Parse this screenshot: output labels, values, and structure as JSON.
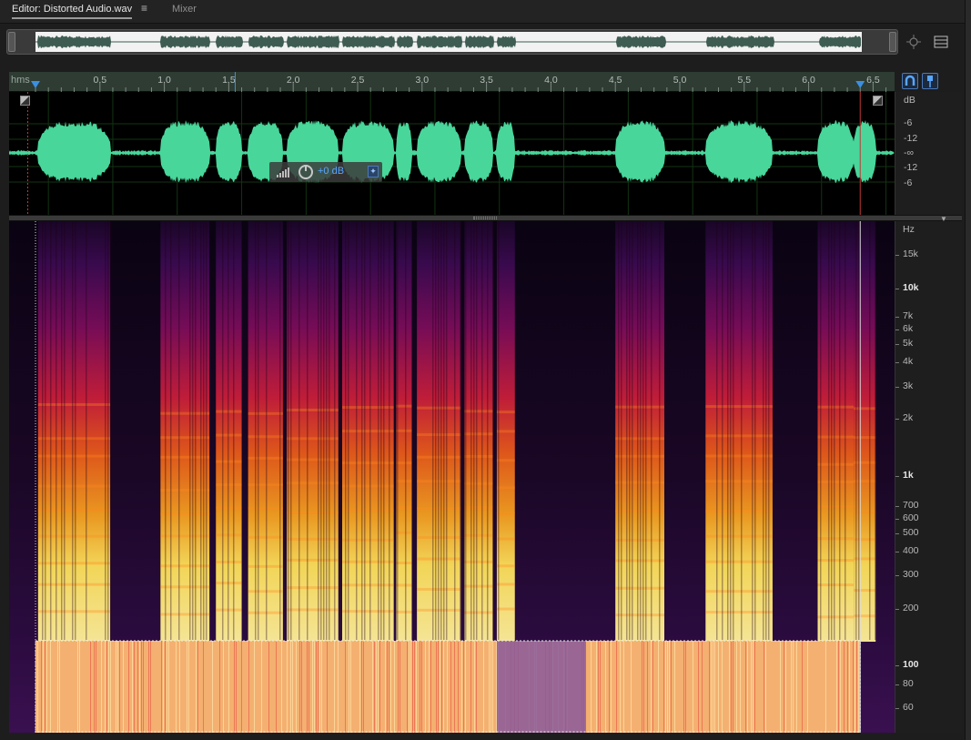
{
  "tabs": {
    "editor_label": "Editor: Distorted Audio.wav",
    "menu_glyph": "≡",
    "mixer_label": "Mixer"
  },
  "ruler": {
    "unit_label": "hms",
    "ticks": [
      "0.5",
      "1.0",
      "1.5",
      "2.0",
      "2.5",
      "3.0",
      "3.5",
      "4.0",
      "4.5",
      "5.0",
      "5.5",
      "6.0",
      "6.5"
    ]
  },
  "waveform": {
    "scale_unit": "dB",
    "scale_labels": [
      "-6",
      "-12",
      "-∞",
      "-12",
      "-6"
    ],
    "gain_hud": "+0 dB"
  },
  "spectral": {
    "scale_unit": "Hz",
    "freq_labels": [
      {
        "text": "15k",
        "bold": false
      },
      {
        "text": "10k",
        "bold": true
      },
      {
        "text": "7k",
        "bold": false
      },
      {
        "text": "6k",
        "bold": false
      },
      {
        "text": "5k",
        "bold": false
      },
      {
        "text": "4k",
        "bold": false
      },
      {
        "text": "3k",
        "bold": false
      },
      {
        "text": "2k",
        "bold": false
      },
      {
        "text": "1k",
        "bold": true
      },
      {
        "text": "700",
        "bold": false
      },
      {
        "text": "600",
        "bold": false
      },
      {
        "text": "500",
        "bold": false
      },
      {
        "text": "400",
        "bold": false
      },
      {
        "text": "300",
        "bold": false
      },
      {
        "text": "200",
        "bold": false
      },
      {
        "text": "100",
        "bold": true
      },
      {
        "text": "80",
        "bold": false
      },
      {
        "text": "60",
        "bold": false
      }
    ]
  },
  "colors": {
    "waveform": "#48d69a",
    "ruler_bg": "#2e3c34",
    "playhead": "#3b8fe0",
    "selection_end": "#c43838"
  },
  "icons": {
    "ov_zoom": "zoom-target-icon",
    "ov_list": "list-icon",
    "snap": "magnet-icon",
    "marker": "marker-pin-icon"
  }
}
